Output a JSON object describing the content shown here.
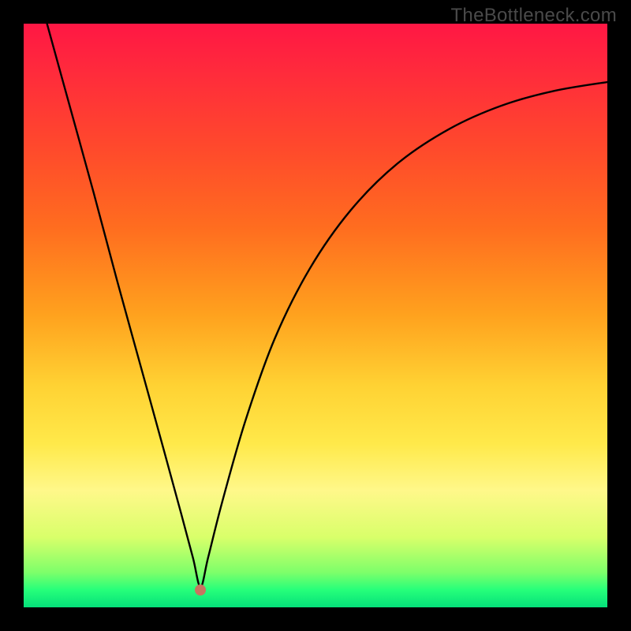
{
  "watermark": "TheBottleneck.com",
  "chart_data": {
    "type": "line",
    "title": "",
    "xlabel": "",
    "ylabel": "",
    "xlim": [
      0,
      1
    ],
    "ylim": [
      0,
      1
    ],
    "min_marker": {
      "x": 0.303,
      "y": 0.03,
      "color": "#c77460"
    },
    "gradient_stops": [
      {
        "pos": 0.0,
        "color": "#ff1744"
      },
      {
        "pos": 0.08,
        "color": "#ff2a3c"
      },
      {
        "pos": 0.22,
        "color": "#ff4b2b"
      },
      {
        "pos": 0.35,
        "color": "#ff6d1f"
      },
      {
        "pos": 0.5,
        "color": "#ffa21e"
      },
      {
        "pos": 0.62,
        "color": "#ffd233"
      },
      {
        "pos": 0.72,
        "color": "#ffe94a"
      },
      {
        "pos": 0.8,
        "color": "#fff88a"
      },
      {
        "pos": 0.88,
        "color": "#d9ff6a"
      },
      {
        "pos": 0.94,
        "color": "#7eff6a"
      },
      {
        "pos": 0.97,
        "color": "#26ff7a"
      },
      {
        "pos": 1.0,
        "color": "#05e07a"
      }
    ],
    "series": [
      {
        "name": "bottleneck-curve",
        "x": [
          0.04,
          0.08,
          0.12,
          0.16,
          0.2,
          0.24,
          0.27,
          0.29,
          0.303,
          0.316,
          0.34,
          0.38,
          0.43,
          0.49,
          0.56,
          0.64,
          0.73,
          0.82,
          0.91,
          1.0
        ],
        "y": [
          1.0,
          0.855,
          0.71,
          0.56,
          0.415,
          0.27,
          0.16,
          0.085,
          0.035,
          0.085,
          0.18,
          0.32,
          0.46,
          0.58,
          0.68,
          0.76,
          0.82,
          0.86,
          0.885,
          0.9
        ]
      }
    ]
  }
}
